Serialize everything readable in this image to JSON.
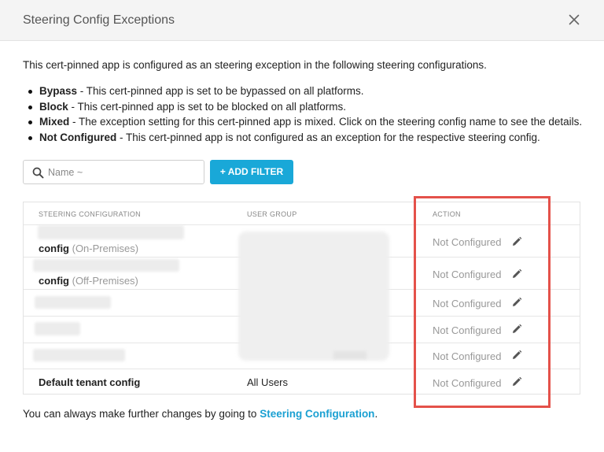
{
  "dialog": {
    "title": "Steering Config Exceptions",
    "close_icon": "close-icon"
  },
  "intro": "This cert-pinned app is configured as an steering exception in the following steering configurations.",
  "bullets": [
    {
      "term": "Bypass",
      "text": " - This cert-pinned app is set to be bypassed on all platforms."
    },
    {
      "term": "Block",
      "text": " - This cert-pinned app is set to be blocked on all platforms."
    },
    {
      "term": "Mixed",
      "text": " - The exception setting for this cert-pinned app is mixed. Click on the steering config name to see the details."
    },
    {
      "term": "Not Configured",
      "text": " - This cert-pinned app is not configured as an exception for the respective steering config."
    }
  ],
  "search": {
    "placeholder": "Name ~",
    "icon": "search-icon"
  },
  "add_filter_label": "+ ADD FILTER",
  "table": {
    "headers": {
      "config": "STEERING CONFIGURATION",
      "group": "USER GROUP",
      "action": "ACTION"
    },
    "rows": [
      {
        "name": "config",
        "env": " (On-Premises)",
        "group": "",
        "action": "Not Configured"
      },
      {
        "name": "config",
        "env": " (Off-Premises)",
        "group": "",
        "action": "Not Configured"
      },
      {
        "name": "",
        "env": "",
        "group": "",
        "action": "Not Configured"
      },
      {
        "name": "",
        "env": "",
        "group": "",
        "action": "Not Configured"
      },
      {
        "name": "",
        "env": "",
        "group": "",
        "action": "Not Configured"
      },
      {
        "name": "Default tenant config",
        "env": "",
        "group": "All Users",
        "action": "Not Configured"
      }
    ]
  },
  "footer": {
    "text": "You can always make further changes by going to ",
    "link": "Steering Configuration",
    "end": "."
  },
  "colors": {
    "accent": "#19a8d8",
    "highlight": "#e4514a",
    "link": "#1aa0d2"
  }
}
